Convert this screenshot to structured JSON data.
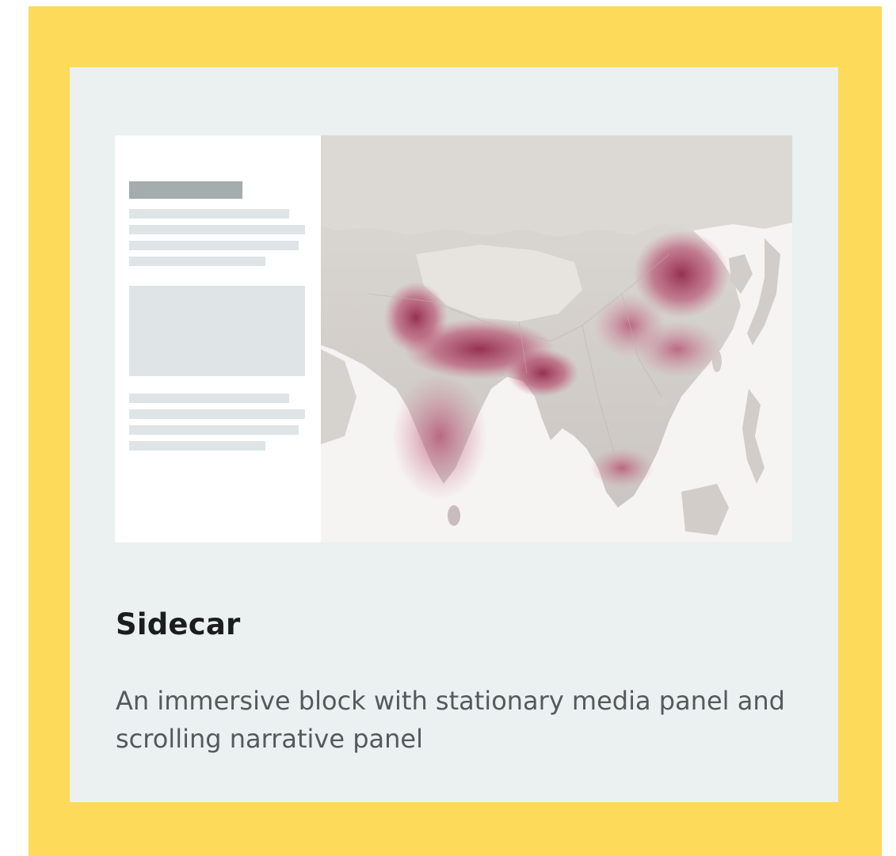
{
  "card": {
    "title": "Sidecar",
    "description": "An immersive block with stationary media panel and scrolling narrative panel"
  },
  "preview": {
    "image_icon": "map-thumbnail",
    "heat_color": "#b0375f",
    "land_color": "#d3cfcb",
    "sea_color": "#f6f3f3"
  },
  "colors": {
    "frame": "#fdda5a",
    "card": "#ebf0f1"
  }
}
